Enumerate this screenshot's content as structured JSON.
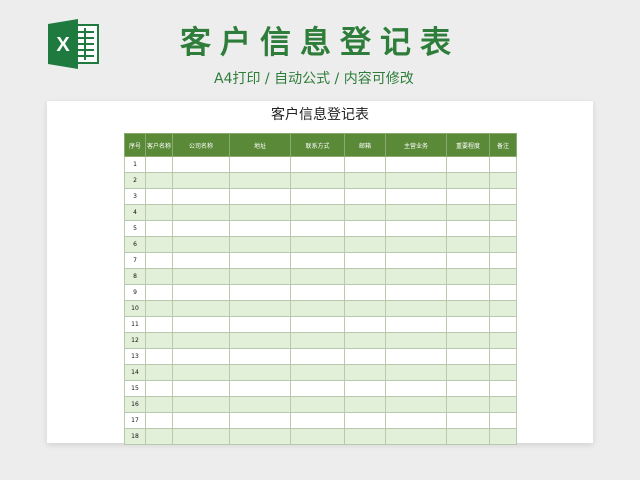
{
  "header": {
    "title": "客户信息登记表",
    "subtitle": "A4打印 / 自动公式 / 内容可修改"
  },
  "logo": {
    "letter": "X",
    "icon": "excel-icon",
    "color": "#1f7a3f"
  },
  "sheet": {
    "title": "客户信息登记表",
    "columns": [
      "序号",
      "客户名称",
      "公司名称",
      "地址",
      "联系方式",
      "邮箱",
      "主营业务",
      "重要程度",
      "备注"
    ],
    "row_numbers": [
      "1",
      "2",
      "3",
      "4",
      "5",
      "6",
      "7",
      "8",
      "9",
      "10",
      "11",
      "12",
      "13",
      "14",
      "15",
      "16",
      "17",
      "18"
    ]
  },
  "colors": {
    "accent": "#2e7d3a",
    "header_bg": "#5a8a38",
    "band": "#e2efd9"
  }
}
